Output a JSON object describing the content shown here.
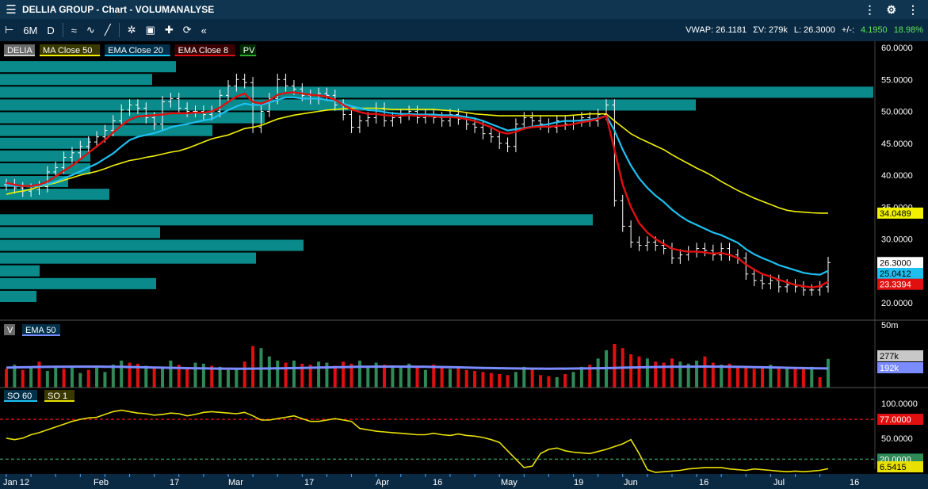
{
  "window": {
    "title": "DELLIA GROUP - Chart - VOLUMANALYSE"
  },
  "toolbar": {
    "period": "6M",
    "interval": "D",
    "vwap": "VWAP: 26.1181",
    "sum_volume": "ΣV: 279k",
    "last": "L: 26.3000",
    "change_label": "+/-:",
    "change": "4.1950",
    "change_pct": "18.98%"
  },
  "colors": {
    "ma50": "#f0f000",
    "ema20": "#1ec0f0",
    "ema8": "#e01010",
    "volume_up": "#2e8b57",
    "volume_down": "#e01010",
    "volume_profile": "#0a8a8a",
    "so_line": "#e8e000",
    "panel_bg": "#000000",
    "toolbar_bg": "#0a2a44"
  },
  "chart_data": [
    {
      "type": "ohlc",
      "legend": [
        "DELIA",
        "MA Close 50",
        "EMA Close 20",
        "EMA Close 8",
        "PV"
      ],
      "ylim": [
        20,
        60
      ],
      "yticks": [
        "60.0000",
        "55.0000",
        "50.0000",
        "45.0000",
        "40.0000",
        "35.0000",
        "30.0000",
        "25.0000",
        "20.0000"
      ],
      "xticks": [
        "Jan 12",
        "Feb",
        "17",
        "Mar",
        "17",
        "Apr",
        "16",
        "May",
        "19",
        "Jun",
        "16",
        "Jul",
        "16"
      ],
      "price_labels": {
        "ma50": "34.0489",
        "last": "26.3000",
        "ema20": "25.0412",
        "ema8": "23.3394"
      },
      "closes": [
        38.5,
        38.0,
        37.5,
        37.8,
        38.2,
        40.5,
        41.2,
        42.8,
        43.5,
        44.5,
        45.2,
        46.0,
        47.0,
        48.5,
        50.2,
        51.0,
        50.5,
        49.0,
        48.0,
        51.5,
        52.0,
        50.5,
        50.0,
        50.0,
        49.5,
        50.0,
        52.5,
        54.0,
        55.0,
        54.5,
        47.5,
        50.0,
        52.0,
        55.0,
        54.0,
        53.5,
        52.5,
        52.0,
        52.8,
        52.5,
        51.0,
        49.5,
        47.5,
        48.5,
        49.0,
        50.5,
        48.5,
        49.0,
        49.5,
        50.0,
        49.0,
        49.5,
        49.0,
        48.5,
        49.5,
        48.8,
        48.0,
        47.5,
        46.5,
        46.0,
        45.0,
        44.5,
        48.0,
        49.0,
        48.5,
        48.0,
        47.5,
        48.5,
        48.0,
        48.5,
        49.0,
        48.5,
        49.5,
        51.0,
        36.0,
        32.0,
        29.5,
        29.0,
        29.5,
        29.0,
        28.5,
        27.0,
        27.5,
        28.0,
        28.5,
        28.2,
        27.5,
        28.5,
        27.5,
        27.0,
        24.5,
        23.5,
        23.0,
        23.5,
        22.5,
        22.8,
        22.5,
        22.0,
        22.0,
        22.5,
        26.3
      ],
      "ma50": [
        37.0,
        37.3,
        37.5,
        37.8,
        38.2,
        38.5,
        38.8,
        39.2,
        39.6,
        40.0,
        40.3,
        40.6,
        41.0,
        41.5,
        41.9,
        42.3,
        42.5,
        42.8,
        43.0,
        43.3,
        43.6,
        43.8,
        44.2,
        44.7,
        45.2,
        45.7,
        46.0,
        46.3,
        46.8,
        47.3,
        47.5,
        47.8,
        48.3,
        48.8,
        49.1,
        49.4,
        49.6,
        49.8,
        50.0,
        50.2,
        50.3,
        50.4,
        50.5,
        50.5,
        50.5,
        50.5,
        50.4,
        50.3,
        50.3,
        50.3,
        50.3,
        50.3,
        50.3,
        50.2,
        50.1,
        50.0,
        49.8,
        49.6,
        49.5,
        49.4,
        49.3,
        49.3,
        49.3,
        49.3,
        49.3,
        49.3,
        49.3,
        49.3,
        49.3,
        49.4,
        49.5,
        49.6,
        49.6,
        49.6,
        48.5,
        47.5,
        46.5,
        45.8,
        45.2,
        44.6,
        44.0,
        43.2,
        42.5,
        41.8,
        41.1,
        40.5,
        39.8,
        39.0,
        38.3,
        37.6,
        37.0,
        36.4,
        35.9,
        35.4,
        34.9,
        34.5,
        34.3,
        34.2,
        34.1,
        34.05,
        34.05
      ],
      "ema20": [
        38.5,
        38.3,
        38.3,
        38.2,
        38.3,
        38.6,
        39.0,
        39.5,
        40.0,
        40.6,
        41.2,
        41.8,
        42.6,
        43.4,
        44.5,
        45.5,
        46.0,
        46.3,
        46.6,
        47.0,
        47.5,
        47.8,
        48.0,
        48.3,
        48.6,
        48.8,
        49.5,
        50.2,
        50.8,
        51.2,
        51.0,
        51.0,
        51.4,
        51.8,
        52.2,
        52.2,
        52.0,
        52.0,
        52.0,
        51.8,
        51.6,
        51.2,
        50.8,
        50.5,
        50.2,
        50.1,
        49.9,
        49.7,
        49.6,
        49.6,
        49.5,
        49.5,
        49.5,
        49.4,
        49.4,
        49.3,
        49.1,
        48.9,
        48.5,
        48.0,
        47.5,
        47.0,
        47.2,
        47.4,
        47.6,
        47.8,
        48.0,
        48.3,
        48.5,
        48.5,
        48.6,
        48.7,
        48.9,
        49.3,
        47.0,
        44.0,
        41.5,
        39.5,
        38.0,
        36.8,
        35.8,
        34.6,
        33.6,
        32.8,
        32.2,
        31.6,
        31.0,
        30.6,
        30.0,
        29.4,
        28.4,
        27.6,
        27.0,
        26.5,
        25.9,
        25.5,
        25.1,
        24.7,
        24.5,
        24.4,
        25.0
      ],
      "ema8": [
        38.8,
        38.5,
        38.3,
        38.3,
        38.5,
        39.0,
        39.8,
        40.7,
        41.5,
        42.5,
        43.5,
        44.5,
        45.5,
        46.7,
        47.8,
        48.7,
        49.2,
        49.3,
        49.4,
        49.5,
        49.7,
        49.7,
        49.7,
        49.8,
        49.8,
        50.0,
        50.6,
        51.5,
        52.3,
        52.8,
        51.5,
        51.2,
        51.7,
        52.6,
        52.9,
        53.0,
        52.8,
        52.6,
        52.5,
        52.3,
        51.8,
        51.0,
        50.3,
        49.9,
        49.6,
        49.6,
        49.4,
        49.3,
        49.3,
        49.4,
        49.3,
        49.3,
        49.2,
        49.1,
        49.1,
        49.0,
        48.8,
        48.5,
        48.0,
        47.5,
        46.8,
        46.5,
        46.8,
        47.3,
        47.5,
        47.6,
        47.6,
        47.7,
        47.8,
        48.0,
        48.3,
        48.5,
        48.8,
        49.3,
        44.0,
        38.5,
        35.0,
        32.5,
        31.0,
        30.0,
        29.2,
        28.5,
        28.2,
        28.0,
        28.0,
        27.9,
        27.7,
        27.8,
        27.5,
        27.0,
        26.0,
        25.2,
        24.5,
        24.1,
        23.6,
        23.2,
        22.8,
        22.6,
        22.4,
        22.6,
        23.3
      ]
    },
    {
      "type": "volume_profile",
      "bins": [
        {
          "price_from": 56,
          "price_to": 58,
          "length": 222
        },
        {
          "price_from": 54,
          "price_to": 56,
          "length": 192
        },
        {
          "price_from": 52,
          "price_to": 54,
          "length": 1102
        },
        {
          "price_from": 50,
          "price_to": 52,
          "length": 878
        },
        {
          "price_from": 48,
          "price_to": 50,
          "length": 334
        },
        {
          "price_from": 46,
          "price_to": 48,
          "length": 268
        },
        {
          "price_from": 44,
          "price_to": 46,
          "length": 114
        },
        {
          "price_from": 42,
          "price_to": 44,
          "length": 114
        },
        {
          "price_from": 40,
          "price_to": 42,
          "length": 114
        },
        {
          "price_from": 38,
          "price_to": 40,
          "length": 86
        },
        {
          "price_from": 36,
          "price_to": 38,
          "length": 138
        },
        {
          "price_from": 32,
          "price_to": 34,
          "length": 748
        },
        {
          "price_from": 30,
          "price_to": 32,
          "length": 202
        },
        {
          "price_from": 28,
          "price_to": 30,
          "length": 383
        },
        {
          "price_from": 26,
          "price_to": 28,
          "length": 323
        },
        {
          "price_from": 24,
          "price_to": 26,
          "length": 50
        },
        {
          "price_from": 22,
          "price_to": 24,
          "length": 197
        },
        {
          "price_from": 20,
          "price_to": 22,
          "length": 46
        }
      ]
    },
    {
      "type": "bar",
      "legend": [
        "V",
        "EMA 50"
      ],
      "yticks": [
        "50m"
      ],
      "labels": {
        "volume": "277k",
        "ema": "192k"
      },
      "ema_level": 192,
      "values": [
        180,
        220,
        170,
        200,
        250,
        160,
        200,
        180,
        210,
        140,
        170,
        190,
        150,
        220,
        260,
        240,
        230,
        210,
        190,
        200,
        260,
        220,
        180,
        240,
        230,
        210,
        200,
        170,
        190,
        250,
        400,
        380,
        300,
        260,
        240,
        260,
        230,
        220,
        250,
        240,
        210,
        250,
        230,
        260,
        200,
        240,
        220,
        210,
        190,
        230,
        200,
        170,
        220,
        190,
        180,
        200,
        170,
        160,
        150,
        140,
        130,
        120,
        150,
        200,
        190,
        120,
        110,
        100,
        130,
        150,
        200,
        220,
        280,
        360,
        420,
        380,
        320,
        300,
        280,
        250,
        240,
        280,
        250,
        230,
        260,
        300,
        240,
        220,
        230,
        200,
        210,
        180,
        200,
        220,
        190,
        200,
        180,
        190,
        200,
        100,
        277
      ],
      "up": [
        0,
        1,
        0,
        1,
        0,
        1,
        1,
        0,
        1,
        1,
        0,
        1,
        1,
        1,
        1,
        0,
        0,
        1,
        0,
        1,
        1,
        0,
        0,
        1,
        1,
        0,
        1,
        1,
        1,
        0,
        0,
        1,
        1,
        1,
        0,
        1,
        0,
        0,
        1,
        1,
        0,
        0,
        0,
        1,
        1,
        1,
        0,
        1,
        1,
        1,
        0,
        1,
        0,
        0,
        1,
        0,
        0,
        0,
        0,
        0,
        0,
        0,
        1,
        1,
        0,
        0,
        0,
        1,
        0,
        1,
        1,
        0,
        1,
        1,
        0,
        0,
        0,
        0,
        1,
        0,
        0,
        0,
        1,
        1,
        1,
        0,
        0,
        1,
        0,
        0,
        0,
        0,
        0,
        1,
        0,
        1,
        0,
        0,
        1,
        0,
        1
      ]
    },
    {
      "type": "line",
      "legend": [
        "SO 60",
        "SO 1"
      ],
      "ylim": [
        0,
        110
      ],
      "yticks": [
        "100.0000",
        "50.0000"
      ],
      "levels": [
        {
          "value": 77,
          "label": "77.0000"
        },
        {
          "value": 20,
          "label": "20.0000"
        }
      ],
      "last_label": "6.5415",
      "values": [
        50,
        48,
        50,
        55,
        58,
        62,
        66,
        70,
        74,
        77,
        79,
        80,
        84,
        88,
        90,
        88,
        86,
        85,
        83,
        84,
        86,
        85,
        82,
        84,
        87,
        88,
        87,
        86,
        85,
        87,
        82,
        76,
        76,
        78,
        80,
        82,
        78,
        74,
        74,
        76,
        78,
        76,
        74,
        64,
        62,
        60,
        59,
        58,
        57,
        56,
        55,
        55,
        57,
        55,
        54,
        56,
        54,
        53,
        51,
        48,
        44,
        32,
        20,
        8,
        10,
        28,
        34,
        36,
        32,
        30,
        29,
        28,
        31,
        34,
        38,
        42,
        48,
        28,
        5,
        1,
        2,
        3,
        4,
        6,
        7,
        8,
        8,
        8,
        6,
        5,
        4,
        6,
        5,
        4,
        3,
        2,
        3,
        2,
        3,
        4,
        6.5
      ]
    }
  ]
}
